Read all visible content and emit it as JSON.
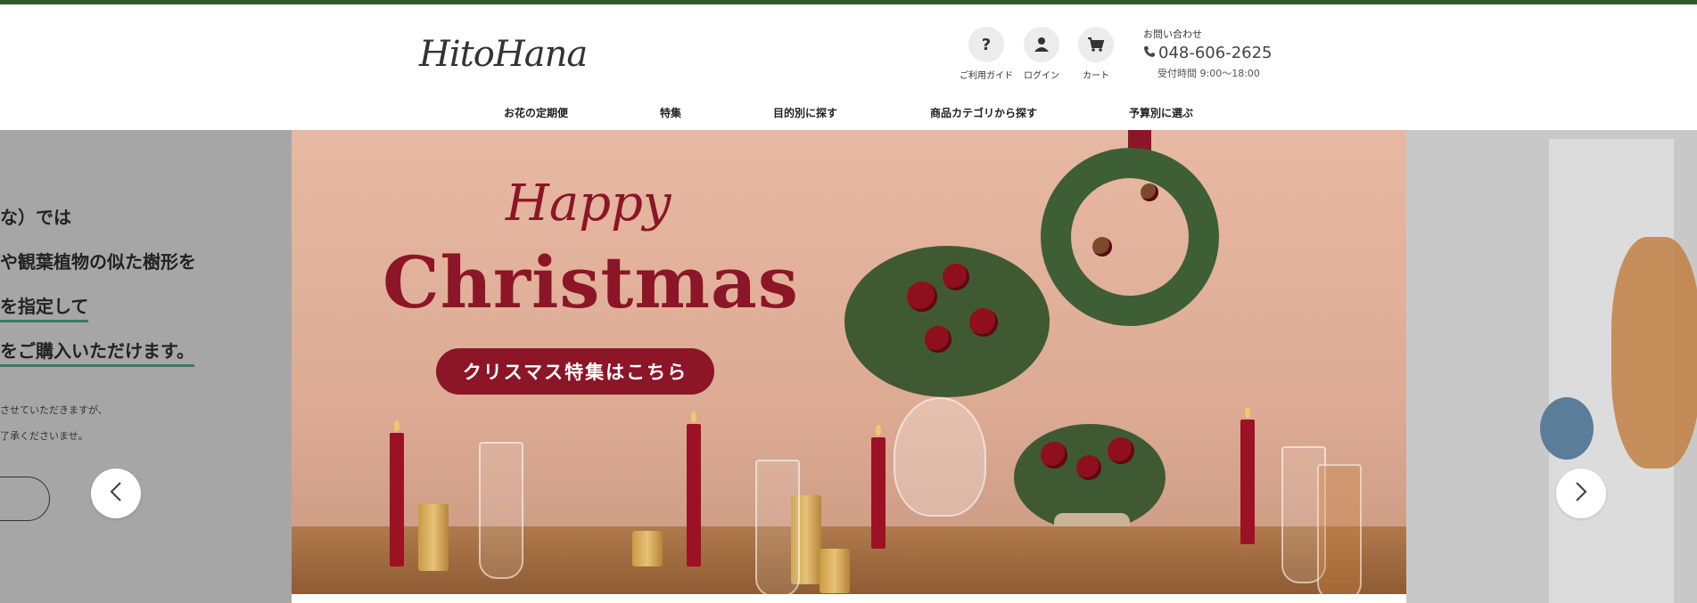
{
  "brand": {
    "logo_text": "HitoHana",
    "accent": "#2e5a2a"
  },
  "utility": {
    "guide_label": "ご利用ガイド",
    "login_label": "ログイン",
    "cart_label": "カート"
  },
  "contact": {
    "title": "お問い合わせ",
    "tel": "048-606-2625",
    "hours": "受付時間 9:00〜18:00"
  },
  "nav": [
    {
      "label": "お花の定期便"
    },
    {
      "label": "特集"
    },
    {
      "label": "目的別に探す"
    },
    {
      "label": "商品カテゴリから探す"
    },
    {
      "label": "予算別に選ぶ"
    }
  ],
  "slider": {
    "left_slide": {
      "lines": [
        "な）では",
        "や観葉植物の似た樹形を",
        "を指定して",
        "をご購入いただけます。"
      ],
      "notes": [
        "させていただきますが、",
        "了承くださいませ。"
      ]
    },
    "main_slide": {
      "happy": "Happy",
      "title": "Christmas",
      "cta": "クリスマス特集はこちら",
      "theme_color": "#8c1527"
    },
    "prev_icon": "chevron-left-icon",
    "next_icon": "chevron-right-icon"
  }
}
